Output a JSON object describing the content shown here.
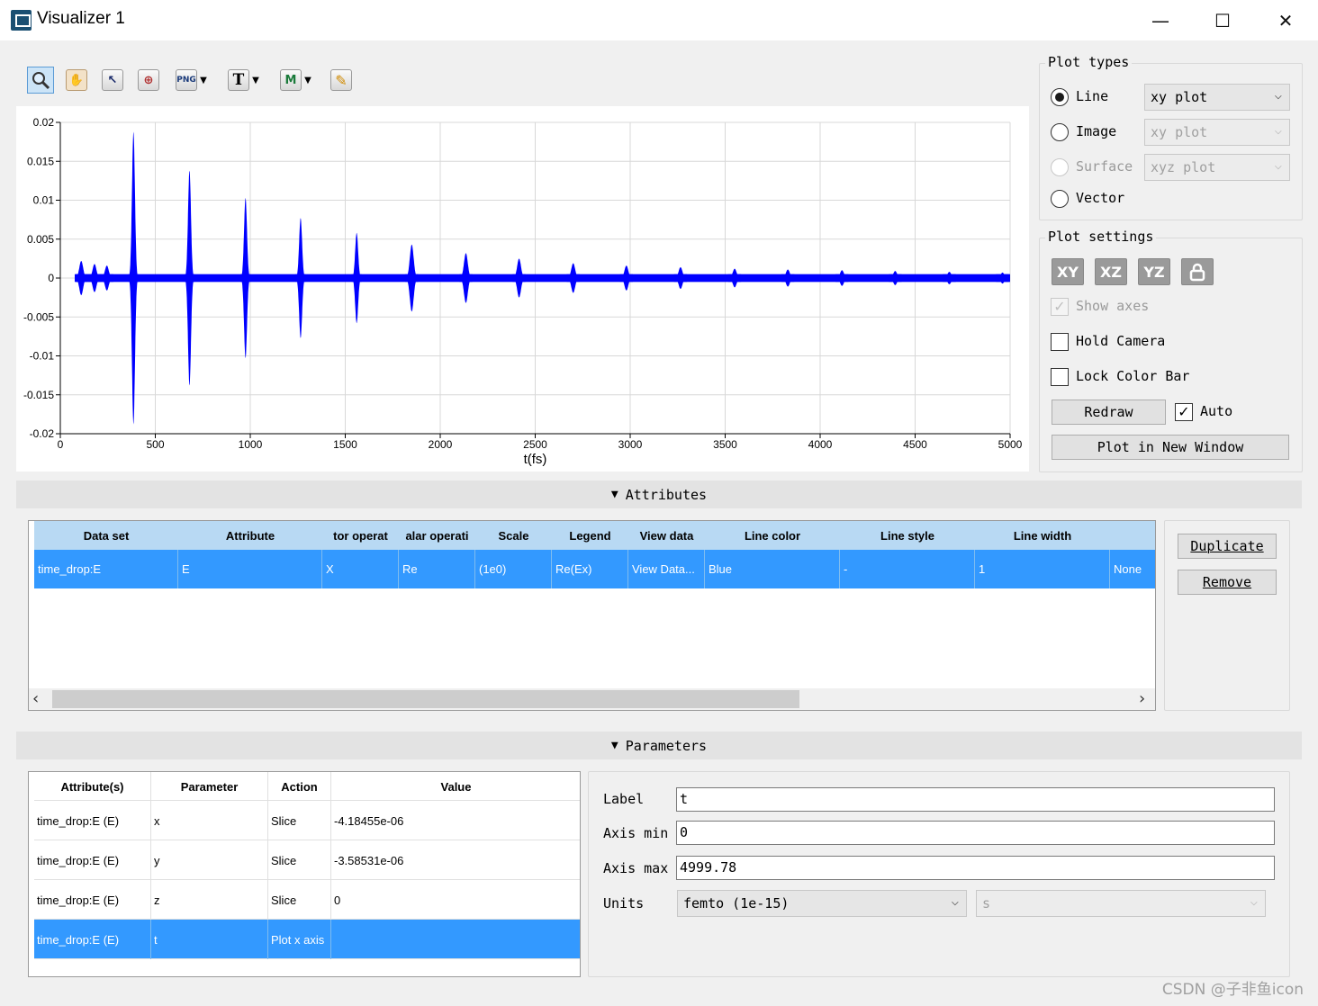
{
  "window": {
    "title": "Visualizer 1",
    "minimize_icon": "—",
    "maximize_icon": "☐",
    "close_icon": "✕"
  },
  "toolbar": {
    "tools": [
      {
        "name": "zoom-tool",
        "icon": "magnifier-icon",
        "glyph": "🔍"
      },
      {
        "name": "pan-tool",
        "icon": "hand-icon",
        "glyph": "✋"
      },
      {
        "name": "select-tool",
        "icon": "arrow-cursor-icon",
        "glyph": "↖"
      },
      {
        "name": "zoom-extents-tool",
        "icon": "zoom-extents-icon",
        "glyph": "⊕"
      },
      {
        "name": "export-png",
        "icon": "png-icon",
        "glyph": "PNG"
      },
      {
        "name": "text-tool",
        "icon": "text-icon",
        "glyph": "T"
      },
      {
        "name": "marker-tool",
        "icon": "marker-icon",
        "glyph": "M"
      },
      {
        "name": "edit-tool",
        "icon": "pencil-icon",
        "glyph": "✎"
      }
    ]
  },
  "chart_data": {
    "type": "line",
    "title": "",
    "xlabel": "t(fs)",
    "ylabel": "",
    "xlim": [
      0,
      5000
    ],
    "ylim": [
      -0.02,
      0.02
    ],
    "x_ticks": [
      "0",
      "500",
      "1000",
      "1500",
      "2000",
      "2500",
      "3000",
      "3500",
      "4000",
      "4500",
      "5000"
    ],
    "y_ticks": [
      "0.02",
      "0.015",
      "0.01",
      "0.005",
      "0",
      "-0.005",
      "-0.01",
      "-0.015",
      "-0.02"
    ],
    "grid": true,
    "series": [
      {
        "color": "#0000ff",
        "pulses": [
          {
            "t": 110,
            "amp": 0.0022
          },
          {
            "t": 180,
            "amp": 0.0018
          },
          {
            "t": 245,
            "amp": 0.0016
          },
          {
            "t": 385,
            "amp": 0.0188
          },
          {
            "t": 680,
            "amp": 0.0138
          },
          {
            "t": 975,
            "amp": 0.0103
          },
          {
            "t": 1265,
            "amp": 0.0077
          },
          {
            "t": 1560,
            "amp": 0.0058
          },
          {
            "t": 1850,
            "amp": 0.0043
          },
          {
            "t": 2135,
            "amp": 0.0032
          },
          {
            "t": 2415,
            "amp": 0.0025
          },
          {
            "t": 2700,
            "amp": 0.0019
          },
          {
            "t": 2980,
            "amp": 0.0016
          },
          {
            "t": 3265,
            "amp": 0.0014
          },
          {
            "t": 3550,
            "amp": 0.0012
          },
          {
            "t": 3830,
            "amp": 0.0011
          },
          {
            "t": 4115,
            "amp": 0.001
          },
          {
            "t": 4395,
            "amp": 0.0009
          },
          {
            "t": 4680,
            "amp": 0.0008
          },
          {
            "t": 4960,
            "amp": 0.0007
          }
        ],
        "baseline_amp": 0.0005
      }
    ]
  },
  "plot_types": {
    "title": "Plot types",
    "options": [
      {
        "label": "Line",
        "selected": true,
        "enabled": true,
        "combo": "xy plot",
        "combo_enabled": true
      },
      {
        "label": "Image",
        "selected": false,
        "enabled": true,
        "combo": "xy plot",
        "combo_enabled": false
      },
      {
        "label": "Surface",
        "selected": false,
        "enabled": false,
        "combo": "xyz plot",
        "combo_enabled": false
      },
      {
        "label": "Vector",
        "selected": false,
        "enabled": true
      }
    ]
  },
  "plot_settings": {
    "title": "Plot settings",
    "view_buttons": [
      "XY",
      "XZ",
      "YZ"
    ],
    "lock_icon": "lock-icon",
    "show_axes": {
      "label": "Show axes",
      "checked": true,
      "enabled": false
    },
    "hold_camera": {
      "label": "Hold Camera",
      "checked": false
    },
    "lock_color_bar": {
      "label": "Lock Color Bar",
      "checked": false
    },
    "redraw_label": "Redraw",
    "auto": {
      "label": "Auto",
      "checked": true
    },
    "new_window_label": "Plot in New Window"
  },
  "attributes": {
    "header": "Attributes",
    "columns": [
      "Data set",
      "Attribute",
      "tor operat",
      "alar operati",
      "Scale",
      "Legend",
      "View data",
      "Line color",
      "Line style",
      "Line width",
      ""
    ],
    "rows": [
      [
        "time_drop:E",
        "E",
        "X",
        "Re",
        "(1e0)",
        "Re(Ex)",
        "View Data...",
        "Blue",
        "-",
        "1",
        "None"
      ]
    ],
    "duplicate_label": "Duplicate",
    "remove_label": "Remove",
    "scroll_left": "‹",
    "scroll_right": "›"
  },
  "parameters": {
    "header": "Parameters",
    "columns": [
      "Attribute(s)",
      "Parameter",
      "Action",
      "Value"
    ],
    "rows": [
      [
        "time_drop:E (E)",
        "x",
        "Slice",
        "-4.18455e-06"
      ],
      [
        "time_drop:E (E)",
        "y",
        "Slice",
        "-3.58531e-06"
      ],
      [
        "time_drop:E (E)",
        "z",
        "Slice",
        "0"
      ],
      [
        "time_drop:E (E)",
        "t",
        "Plot x axis",
        ""
      ]
    ],
    "selected_row": 3,
    "form": {
      "label_caption": "Label",
      "label_value": "t",
      "axis_min_caption": "Axis min",
      "axis_min_value": "0",
      "axis_max_caption": "Axis max",
      "axis_max_value": "4999.78",
      "units_caption": "Units",
      "units_value": "femto (1e-15)",
      "units_suffix": "s"
    }
  },
  "watermark": "CSDN @子非鱼icon"
}
